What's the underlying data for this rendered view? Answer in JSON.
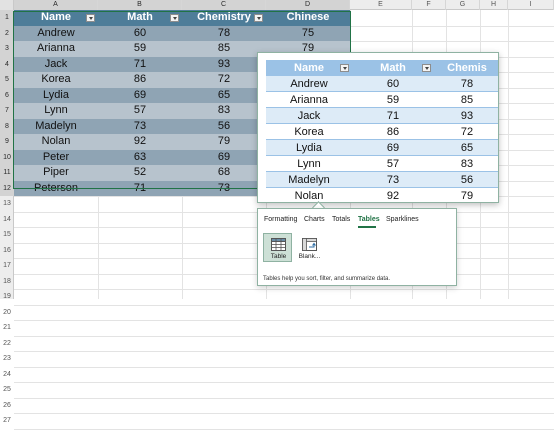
{
  "sheet": {
    "columns": [
      "A",
      "B",
      "C",
      "D",
      "E",
      "F",
      "G",
      "H",
      "I"
    ],
    "rows": [
      "1",
      "2",
      "3",
      "4",
      "5",
      "6",
      "7",
      "8",
      "9",
      "10",
      "11",
      "12",
      "13",
      "14",
      "15",
      "16",
      "17",
      "18",
      "19",
      "20",
      "21",
      "22",
      "23",
      "24",
      "25",
      "26",
      "27"
    ]
  },
  "table": {
    "headers": [
      "Name",
      "Math",
      "Chemistry",
      "Chinese"
    ],
    "rows": [
      [
        "Andrew",
        "60",
        "78",
        "75"
      ],
      [
        "Arianna",
        "59",
        "85",
        "79"
      ],
      [
        "Jack",
        "71",
        "93",
        ""
      ],
      [
        "Korea",
        "86",
        "72",
        ""
      ],
      [
        "Lydia",
        "69",
        "65",
        ""
      ],
      [
        "Lynn",
        "57",
        "83",
        ""
      ],
      [
        "Madelyn",
        "73",
        "56",
        ""
      ],
      [
        "Nolan",
        "92",
        "79",
        ""
      ],
      [
        "Peter",
        "63",
        "69",
        ""
      ],
      [
        "Piper",
        "52",
        "68",
        ""
      ],
      [
        "Peterson",
        "71",
        "73",
        ""
      ]
    ]
  },
  "preview": {
    "headers": [
      "Name",
      "Math",
      "Chemis"
    ],
    "rows": [
      [
        "Andrew",
        "60",
        "78"
      ],
      [
        "Arianna",
        "59",
        "85"
      ],
      [
        "Jack",
        "71",
        "93"
      ],
      [
        "Korea",
        "86",
        "72"
      ],
      [
        "Lydia",
        "69",
        "65"
      ],
      [
        "Lynn",
        "57",
        "83"
      ],
      [
        "Madelyn",
        "73",
        "56"
      ],
      [
        "Nolan",
        "92",
        "79"
      ]
    ]
  },
  "quick_analysis": {
    "tabs": [
      "Formatting",
      "Charts",
      "Totals",
      "Tables",
      "Sparklines"
    ],
    "active_tab": "Tables",
    "tiles": [
      {
        "label": "Table",
        "icon": "table-icon"
      },
      {
        "label": "Blank...",
        "icon": "pivot-table-icon"
      }
    ],
    "description": "Tables help you sort, filter, and summarize data."
  },
  "colors": {
    "table_header": "#4e7d99",
    "band_dark": "#8fa4b4",
    "band_light": "#b7c3cd",
    "preview_header": "#9bc2e6",
    "preview_band": "#ddebf7",
    "accent": "#217346"
  }
}
